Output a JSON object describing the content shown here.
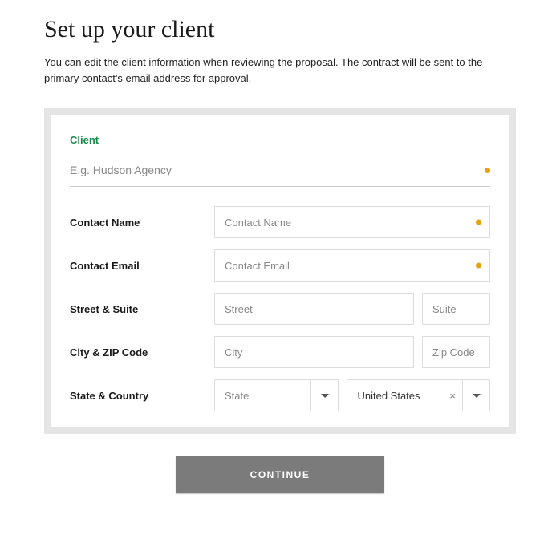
{
  "header": {
    "title": "Set up your client",
    "subtitle": "You can edit the client information when reviewing the proposal. The contract will be sent to the primary contact's email address for approval."
  },
  "form": {
    "section_label": "Client",
    "client_placeholder": "E.g. Hudson Agency",
    "fields": {
      "contact_name": {
        "label": "Contact Name",
        "placeholder": "Contact Name"
      },
      "contact_email": {
        "label": "Contact Email",
        "placeholder": "Contact Email"
      },
      "street_suite": {
        "label": "Street & Suite",
        "street_placeholder": "Street",
        "suite_placeholder": "Suite"
      },
      "city_zip": {
        "label": "City & ZIP Code",
        "city_placeholder": "City",
        "zip_placeholder": "Zip Code"
      },
      "state_country": {
        "label": "State & Country",
        "state_placeholder": "State",
        "country_value": "United States"
      }
    }
  },
  "actions": {
    "continue_label": "CONTINUE"
  }
}
